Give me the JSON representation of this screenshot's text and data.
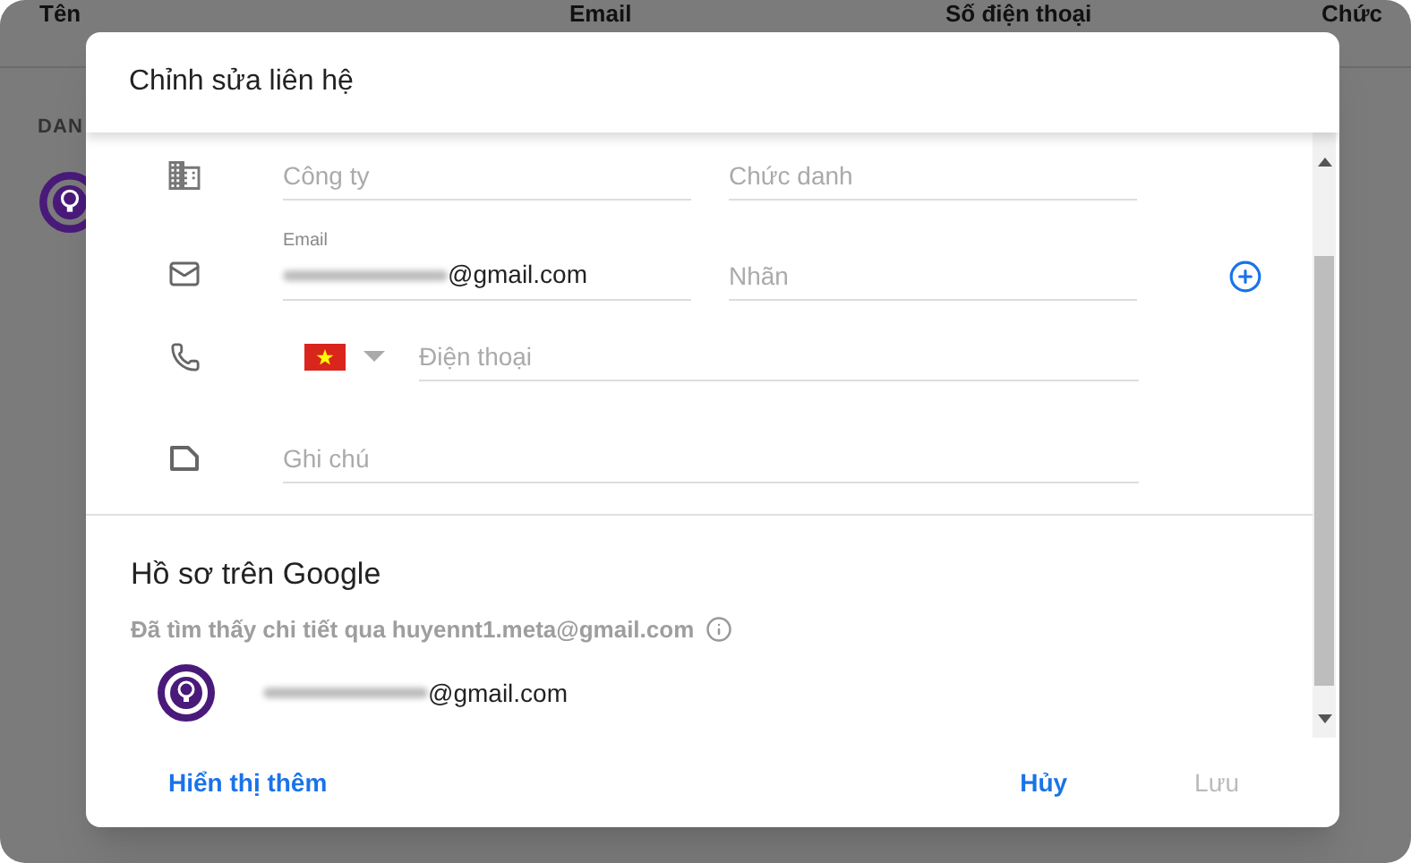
{
  "background": {
    "columns": [
      "Tên",
      "Email",
      "Số điện thoại",
      "Chức"
    ],
    "section_label": "DAN"
  },
  "dialog": {
    "title": "Chỉnh sửa liên hệ",
    "rows": [
      {
        "kind": "company",
        "fields": [
          {
            "placeholder": "Công ty"
          },
          {
            "placeholder": "Chức danh"
          }
        ]
      },
      {
        "kind": "email",
        "label": "Email",
        "value": "@gmail.com",
        "label_placeholder": "Nhãn"
      },
      {
        "kind": "phone",
        "placeholder": "Điện thoại"
      },
      {
        "kind": "note",
        "placeholder": "Ghi chú"
      }
    ],
    "google_profile": {
      "title": "Hồ sơ trên Google",
      "subtitle": "Đã tìm thấy chi tiết qua huyennt1.meta@gmail.com",
      "email": "@gmail.com"
    },
    "footer": {
      "show_more": "Hiển thị thêm",
      "cancel": "Hủy",
      "save": {
        "label": "Lưu",
        "disabled": true
      }
    }
  }
}
